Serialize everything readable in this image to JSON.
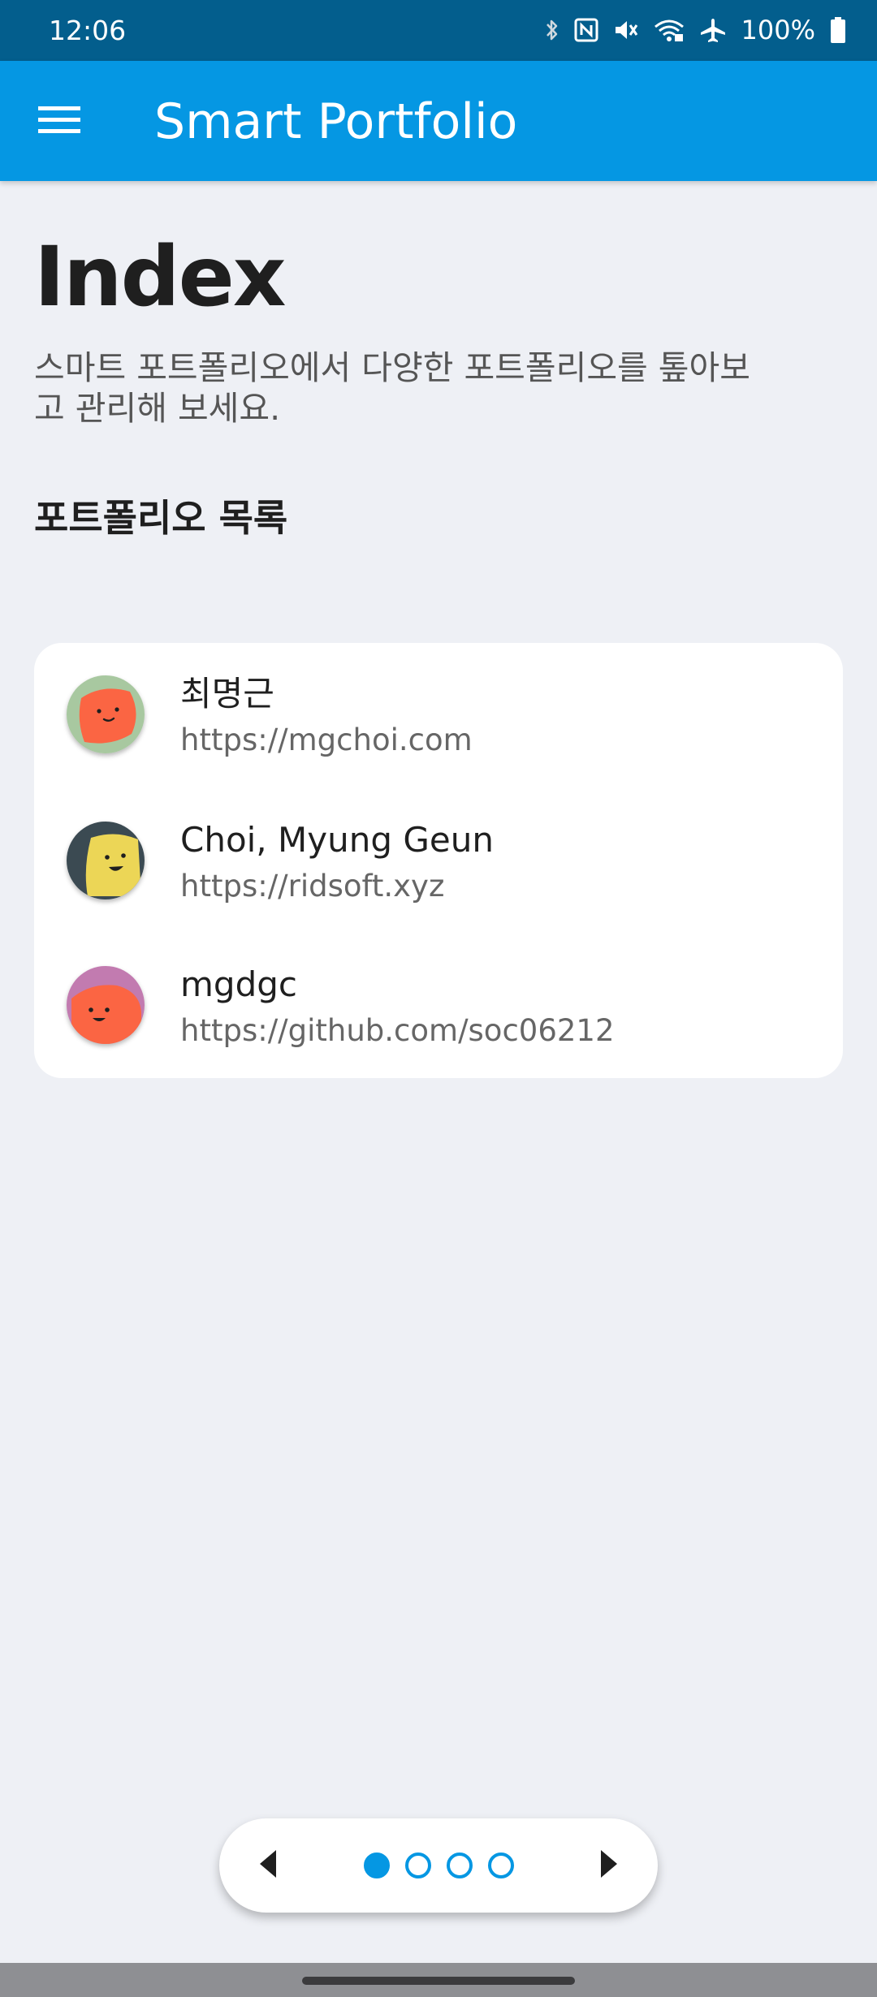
{
  "status_bar": {
    "time": "12:06",
    "battery_percent": "100%",
    "icons": [
      "bluetooth-icon",
      "nfc-icon",
      "vibrate-off-icon",
      "wifi-icon",
      "airplane-mode-icon",
      "battery-icon"
    ]
  },
  "app_bar": {
    "title": "Smart Portfolio",
    "menu_icon": "hamburger-menu-icon",
    "color": "#0597e3"
  },
  "main": {
    "title": "Index",
    "subtitle": "스마트 포트폴리오에서 다양한 포트폴리오를 톺아보고 관리해 보세요.",
    "section_heading": "포트폴리오 목록"
  },
  "portfolios": [
    {
      "name": "최명근",
      "url": "https://mgchoi.com",
      "avatar_colors": [
        "#a8c8a0",
        "#fb6543"
      ]
    },
    {
      "name": "Choi, Myung Geun",
      "url": "https://ridsoft.xyz",
      "avatar_colors": [
        "#3b4a52",
        "#ecd656"
      ]
    },
    {
      "name": "mgdgc",
      "url": "https://github.com/soc06212",
      "avatar_colors": [
        "#c27bb0",
        "#fb6543"
      ]
    }
  ],
  "pager": {
    "page_count": 4,
    "current_page": 1,
    "prev_icon": "caret-left-icon",
    "next_icon": "caret-right-icon",
    "color": "#0597e3"
  }
}
